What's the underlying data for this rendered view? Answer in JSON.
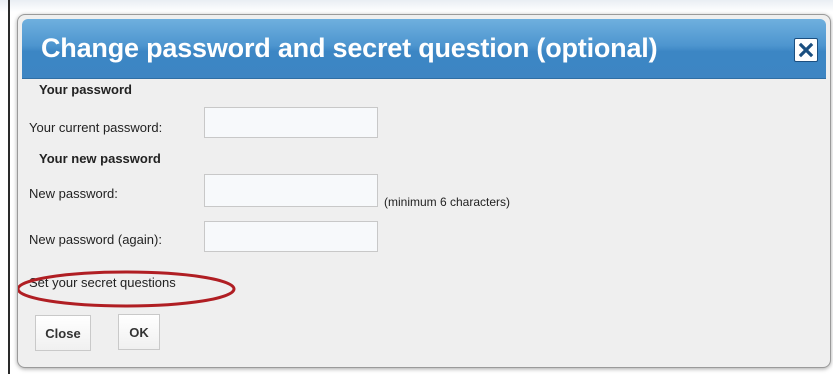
{
  "dialog": {
    "title": "Change password and secret question (optional)",
    "close_icon": "close-icon"
  },
  "sections": {
    "current": {
      "heading": "Your password",
      "current_password_label": "Your current password:",
      "current_password_value": ""
    },
    "new": {
      "heading": "Your new password",
      "new_password_label": "New password:",
      "new_password_value": "",
      "new_password_hint": "(minimum 6 characters)",
      "new_password_again_label": "New password (again):",
      "new_password_again_value": ""
    }
  },
  "secret_questions_link": "Set your secret questions",
  "annotation": {
    "color": "#b01e23"
  },
  "buttons": {
    "close_label": "Close",
    "ok_label": "OK"
  },
  "colors": {
    "titlebar": "#4d95cf",
    "dialog_bg": "#efefef"
  }
}
